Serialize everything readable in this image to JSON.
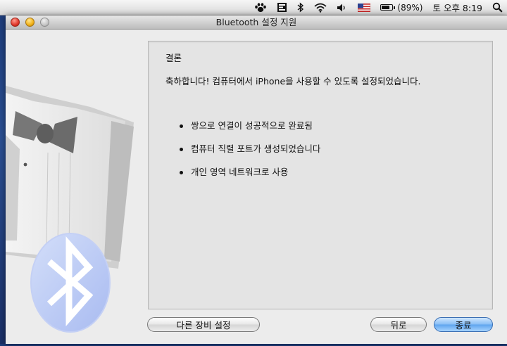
{
  "menubar": {
    "icons": [
      "paw-icon",
      "script-icon",
      "bluetooth-icon",
      "wifi-icon",
      "volume-icon",
      "us-flag-icon",
      "battery-icon",
      "spotlight-icon"
    ],
    "battery": {
      "level": 0.89,
      "label": "(89%)"
    },
    "clock": "토 오후 8:19"
  },
  "window": {
    "title": "Bluetooth 설정 지원"
  },
  "content": {
    "heading": "결론",
    "message": "축하합니다!  컴퓨터에서 iPhone을 사용할 수 있도록 설정되었습니다.",
    "bullets": [
      "쌍으로 연결이 성공적으로 완료됨",
      "컴퓨터 직렬 포트가 생성되었습니다",
      "개인 영역 네트워크로 사용"
    ]
  },
  "buttons": {
    "other_device": "다른 장비 설정",
    "back": "뒤로",
    "done": "종료"
  },
  "colors": {
    "default_button": "#5ea4ee",
    "bluetooth_badge": "#b9c8f5"
  }
}
